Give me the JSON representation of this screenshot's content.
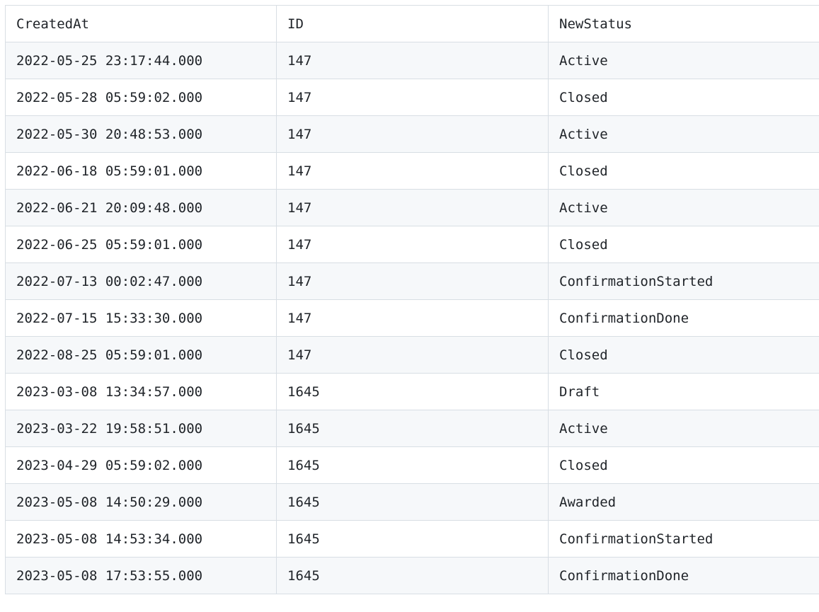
{
  "table": {
    "headers": [
      "CreatedAt",
      "ID",
      "NewStatus"
    ],
    "rows": [
      [
        "2022-05-25 23:17:44.000",
        "147",
        "Active"
      ],
      [
        "2022-05-28 05:59:02.000",
        "147",
        "Closed"
      ],
      [
        "2022-05-30 20:48:53.000",
        "147",
        "Active"
      ],
      [
        "2022-06-18 05:59:01.000",
        "147",
        "Closed"
      ],
      [
        "2022-06-21 20:09:48.000",
        "147",
        "Active"
      ],
      [
        "2022-06-25 05:59:01.000",
        "147",
        "Closed"
      ],
      [
        "2022-07-13 00:02:47.000",
        "147",
        "ConfirmationStarted"
      ],
      [
        "2022-07-15 15:33:30.000",
        "147",
        "ConfirmationDone"
      ],
      [
        "2022-08-25 05:59:01.000",
        "147",
        "Closed"
      ],
      [
        "2023-03-08 13:34:57.000",
        "1645",
        "Draft"
      ],
      [
        "2023-03-22 19:58:51.000",
        "1645",
        "Active"
      ],
      [
        "2023-04-29 05:59:02.000",
        "1645",
        "Closed"
      ],
      [
        "2023-05-08 14:50:29.000",
        "1645",
        "Awarded"
      ],
      [
        "2023-05-08 14:53:34.000",
        "1645",
        "ConfirmationStarted"
      ],
      [
        "2023-05-08 17:53:55.000",
        "1645",
        "ConfirmationDone"
      ]
    ]
  }
}
